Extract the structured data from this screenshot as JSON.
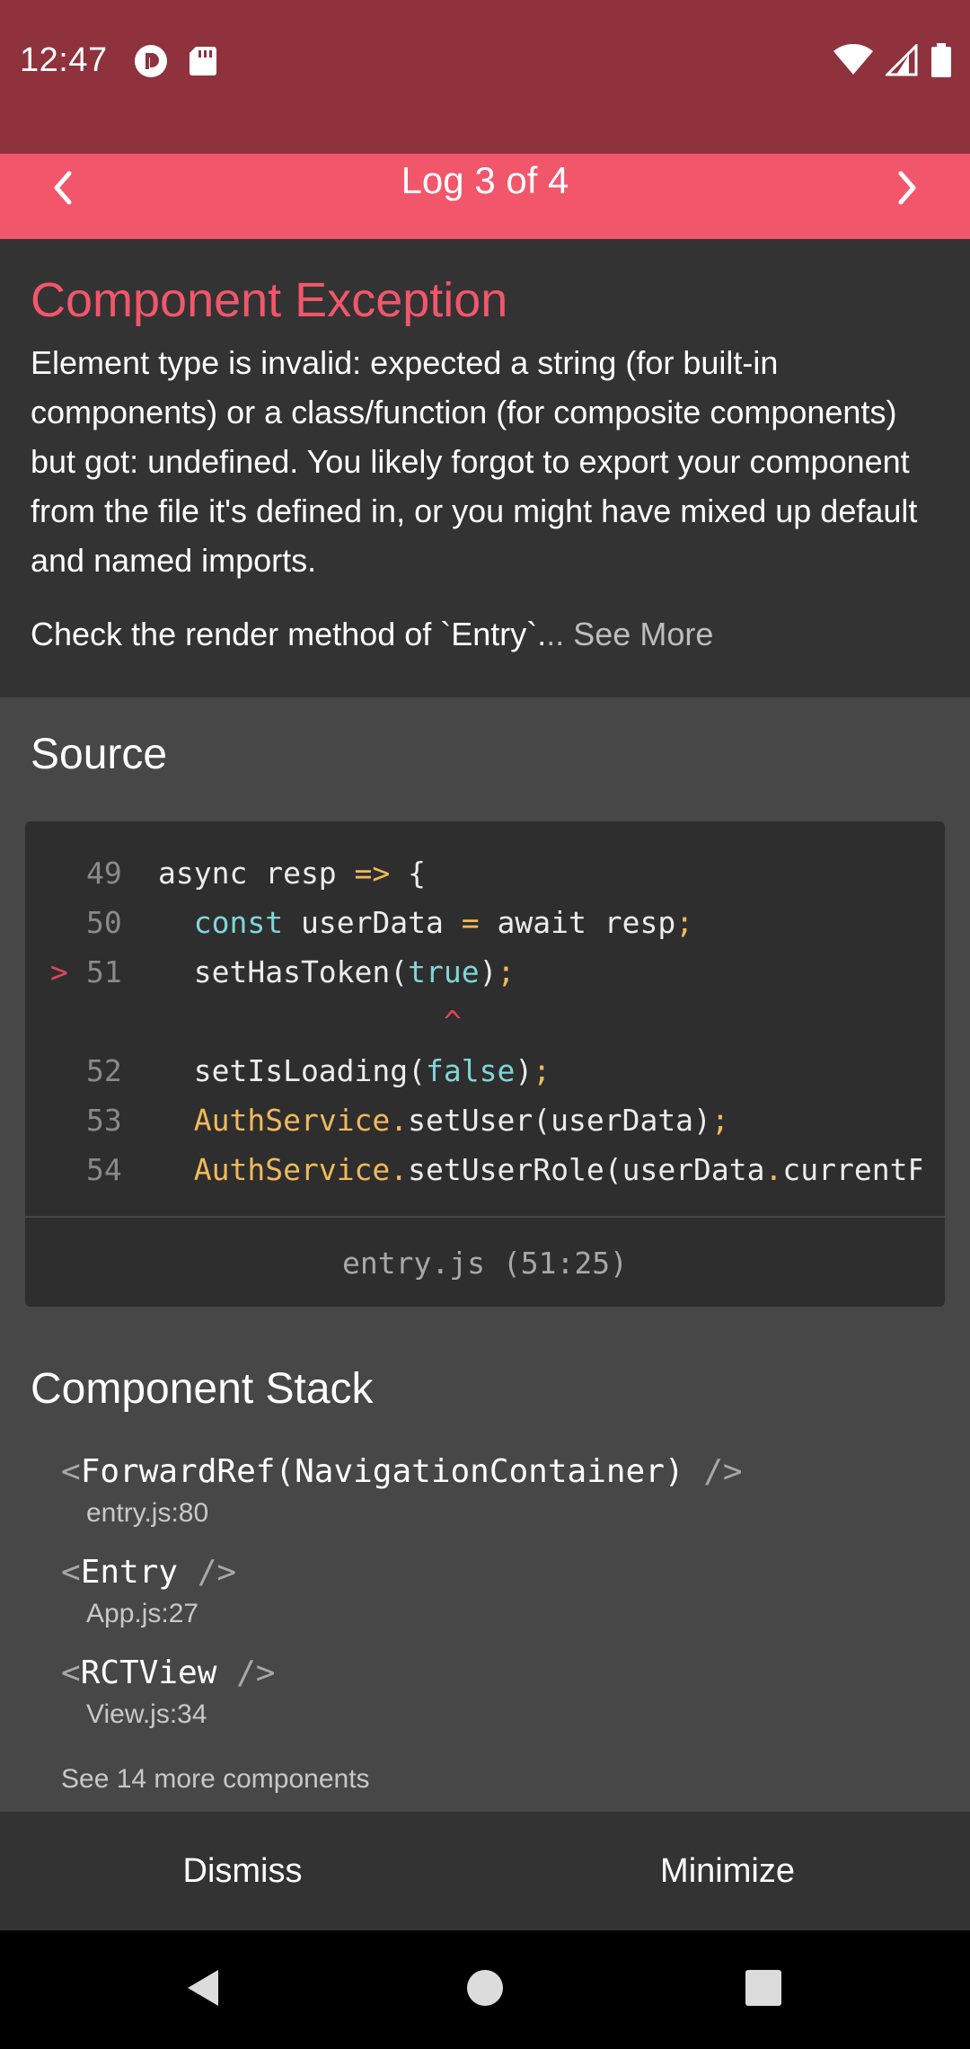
{
  "status_bar": {
    "time": "12:47",
    "left_icons": [
      "notification-badge-icon",
      "sd-card-icon"
    ],
    "right_icons": [
      "wifi-icon",
      "cell-signal-icon",
      "battery-icon"
    ]
  },
  "header": {
    "title": "Log 3 of 4",
    "prev_icon": "chevron-left-icon",
    "next_icon": "chevron-right-icon",
    "color": "#f2566a"
  },
  "error": {
    "title": "Component Exception",
    "message": "Element type is invalid: expected a string (for built-in components) or a class/function (for composite components) but got: undefined. You likely forgot to export your component from the file it's defined in, or you might have mixed up default and named imports.",
    "check_text": "Check the render method of `Entry`.",
    "see_more": ".. See More"
  },
  "source": {
    "title": "Source",
    "lines": [
      {
        "num": "49",
        "marker": "",
        "tokens": [
          [
            "async resp ",
            "plain"
          ],
          [
            "=>",
            "op"
          ],
          [
            " {",
            "plain"
          ]
        ]
      },
      {
        "num": "50",
        "marker": "",
        "tokens": [
          [
            "  ",
            "plain"
          ],
          [
            "const",
            "kw"
          ],
          [
            " userData ",
            "plain"
          ],
          [
            "=",
            "op"
          ],
          [
            " await resp",
            "plain"
          ],
          [
            ";",
            "op"
          ]
        ]
      },
      {
        "num": "51",
        "marker": ">",
        "tokens": [
          [
            "  setHasToken(",
            "plain"
          ],
          [
            "true",
            "kw"
          ],
          [
            ")",
            "plain"
          ],
          [
            ";",
            "op"
          ]
        ]
      },
      {
        "num": "",
        "marker": "",
        "tokens": [
          [
            "                ^",
            "caret"
          ]
        ]
      },
      {
        "num": "52",
        "marker": "",
        "tokens": [
          [
            "  setIsLoading(",
            "plain"
          ],
          [
            "false",
            "kw"
          ],
          [
            ")",
            "plain"
          ],
          [
            ";",
            "op"
          ]
        ]
      },
      {
        "num": "53",
        "marker": "",
        "tokens": [
          [
            "  ",
            "plain"
          ],
          [
            "AuthService",
            "obj"
          ],
          [
            ".",
            "op"
          ],
          [
            "setUser(userData)",
            "plain"
          ],
          [
            ";",
            "op"
          ]
        ]
      },
      {
        "num": "54",
        "marker": "",
        "tokens": [
          [
            "  ",
            "plain"
          ],
          [
            "AuthService",
            "obj"
          ],
          [
            ".",
            "op"
          ],
          [
            "setUserRole(userData",
            "plain"
          ],
          [
            ".",
            "op"
          ],
          [
            "currentF",
            "plain"
          ]
        ]
      }
    ],
    "file_location": "entry.js (51:25)"
  },
  "component_stack": {
    "title": "Component Stack",
    "items": [
      {
        "name": "ForwardRef(NavigationContainer)",
        "file": "entry.js:80"
      },
      {
        "name": "Entry",
        "file": "App.js:27"
      },
      {
        "name": "RCTView",
        "file": "View.js:34"
      }
    ],
    "see_more": "See 14 more components"
  },
  "footer": {
    "dismiss": "Dismiss",
    "minimize": "Minimize"
  },
  "nav_bar": {
    "back_icon": "back-triangle-icon",
    "home_icon": "home-circle-icon",
    "recents_icon": "recents-square-icon"
  },
  "colors": {
    "status_bar": "#8f323d",
    "accent": "#f2566a",
    "keyword": "#82d5d8",
    "operator": "#f1b95c"
  }
}
